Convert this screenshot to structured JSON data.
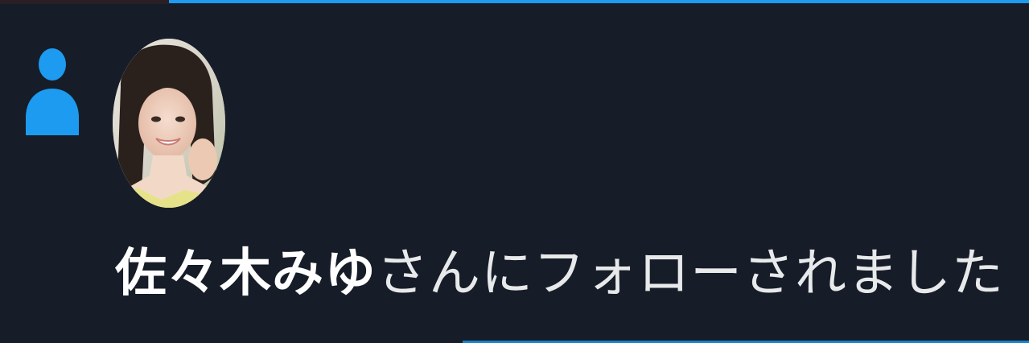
{
  "notification": {
    "type": "follow",
    "icon": "person-icon",
    "accent_color": "#1d9bf0",
    "background_color": "#161d28",
    "user_name": "佐々木みゆ",
    "action_text": "さんにフォローされました"
  }
}
